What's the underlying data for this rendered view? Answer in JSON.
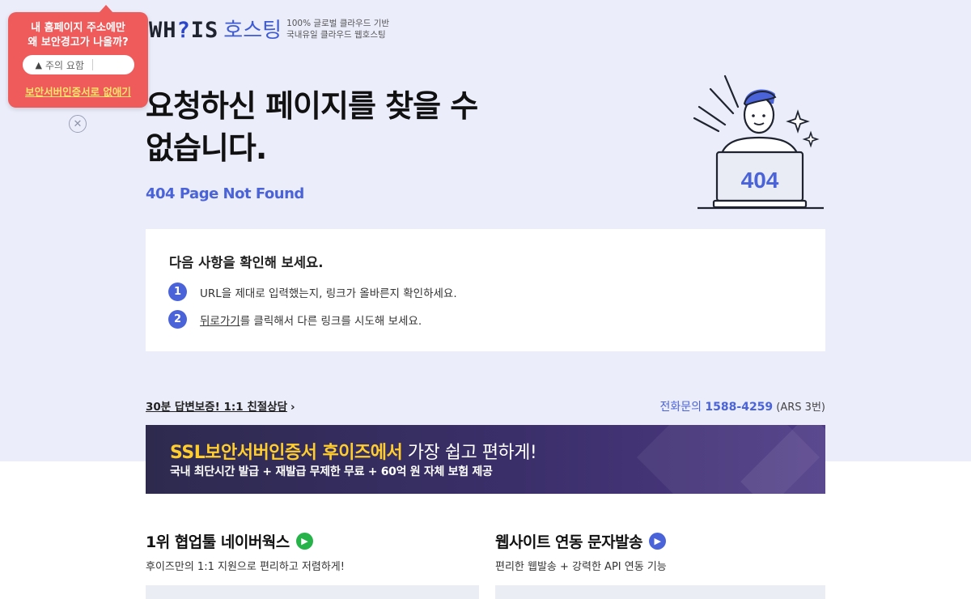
{
  "header": {
    "logo_text_left": "WH",
    "logo_text_q": "?",
    "logo_text_right": "IS",
    "logo_host": "호스팅",
    "tagline_1": "100% 글로벌 클라우드 기반",
    "tagline_2": "국내유일 클라우드 웹호스팅"
  },
  "popup": {
    "title_line1": "내 홈페이지 주소에만",
    "title_line2": "왜 보안경고가 나올까?",
    "warning_icon": "warning-triangle-icon",
    "warning_text": "주의 요함",
    "link": "보안서버인증서로 없애기",
    "close_icon": "close-circle-icon",
    "color": "#ef5a5a"
  },
  "main": {
    "title_line1": "요청하신 페이지를 찾을 수",
    "title_line2": "없습니다.",
    "subtitle": "404 Page Not Found",
    "illustration_text": "404",
    "accent": "#4a63d9"
  },
  "checklist": {
    "title": "다음 사항을 확인해 보세요.",
    "items": [
      {
        "num": "1",
        "text": "URL을 제대로 입력했는지, 링크가 올바른지 확인하세요."
      },
      {
        "num": "2",
        "link": "뒤로가기",
        "text": "를 클릭해서 다른 링크를 시도해 보세요."
      }
    ]
  },
  "contact": {
    "consult": "30분 답변보증! 1:1 친절상담",
    "consult_arrow": "›",
    "phone_label": "전화문의 ",
    "phone_number": "1588-4259",
    "phone_note": " (ARS 3번)"
  },
  "banner": {
    "title_highlight": "SSL보안서버인증서 후이즈에서",
    "title_rest": " 가장 쉽고 편하게!",
    "subtitle": "국내 최단시간 발급 + 재발급 무제한 무료 + 60억 원 자체 보험 제공"
  },
  "cards": [
    {
      "title": "1위 협업툴 네이버웍스",
      "desc": "후이즈만의 1:1 지원으로 편리하고 저렴하게!",
      "icon": "arrow-right-circle-icon"
    },
    {
      "title": "웹사이트 연동 문자발송",
      "desc": "편리한 웹발송 + 강력한 API 연동 기능",
      "icon": "arrow-right-circle-icon"
    }
  ]
}
